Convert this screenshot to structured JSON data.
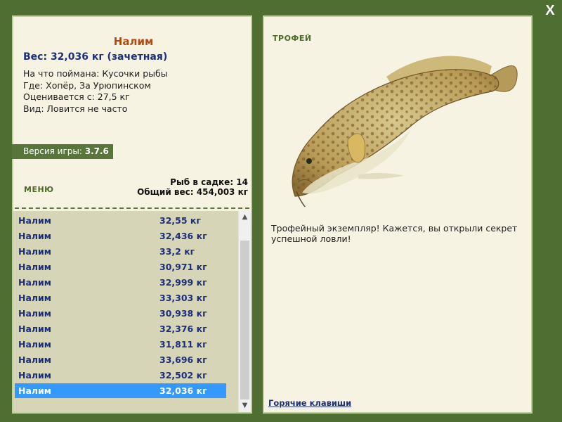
{
  "window": {
    "close_label": "X"
  },
  "fish": {
    "name": "Налим",
    "weight_line": "Вес: 32,036 кг (зачетная)",
    "bait_line": "На что поймана: Кусочки рыбы",
    "place_line": "Где: Хопёр, За Урюпинском",
    "rated_line": "Оценивается с: 27,5 кг",
    "kind_line": "Вид: Ловится не часто"
  },
  "version": {
    "label": "Версия игры: ",
    "value": "3.7.6"
  },
  "menu_label": "МЕНЮ",
  "stats": {
    "count_line": "Рыб в садке: 14",
    "total_line": "Общий вес: 454,003 кг"
  },
  "catch_list": [
    {
      "name": "Налим",
      "weight": "32,55 кг"
    },
    {
      "name": "Налим",
      "weight": "32,436 кг"
    },
    {
      "name": "Налим",
      "weight": "33,2 кг"
    },
    {
      "name": "Налим",
      "weight": "30,971 кг"
    },
    {
      "name": "Налим",
      "weight": "32,999 кг"
    },
    {
      "name": "Налим",
      "weight": "33,303 кг"
    },
    {
      "name": "Налим",
      "weight": "30,938 кг"
    },
    {
      "name": "Налим",
      "weight": "32,376 кг"
    },
    {
      "name": "Налим",
      "weight": "31,811 кг"
    },
    {
      "name": "Налим",
      "weight": "33,696 кг"
    },
    {
      "name": "Налим",
      "weight": "32,502 кг"
    },
    {
      "name": "Налим",
      "weight": "32,036 кг",
      "selected": true
    }
  ],
  "trophy": {
    "label": "ТРОФЕЙ",
    "text": "Трофейный экземпляр! Кажется, вы открыли секрет успешной ловли!",
    "hotkeys_label": "Горячие клавиши"
  },
  "icons": {
    "scroll_up": "scroll-up-icon",
    "scroll_down": "scroll-down-icon",
    "fish_image": "burbot-fish-image"
  },
  "colors": {
    "background": "#4e6e32",
    "panel": "#f6f3e2",
    "accent_green": "#58753a",
    "fish_name": "#b54a10",
    "text_blue": "#1d2f7c",
    "selection": "#3399ff"
  }
}
